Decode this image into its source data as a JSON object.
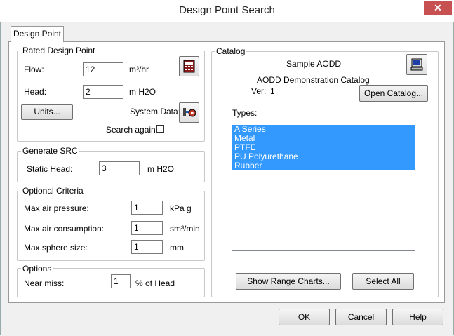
{
  "window": {
    "title": "Design Point Search",
    "close_glyph": "✕"
  },
  "tab": {
    "label": "Design Point"
  },
  "rated": {
    "legend": "Rated Design Point",
    "flow_label": "Flow:",
    "flow_value": "12",
    "flow_unit": "m³/hr",
    "head_label": "Head:",
    "head_value": "2",
    "head_unit": "m H2O",
    "units_button": "Units...",
    "system_data_label": "System Data:",
    "search_again_label": "Search again:",
    "search_again_checked": false
  },
  "generate": {
    "legend": "Generate SRC",
    "static_head_label": "Static Head:",
    "static_head_value": "3",
    "static_head_unit": "m H2O"
  },
  "optional": {
    "legend": "Optional Criteria",
    "rows": [
      {
        "label": "Max air pressure:",
        "value": "1",
        "unit": "kPa g"
      },
      {
        "label": "Max air consumption:",
        "value": "1",
        "unit": "sm³/min"
      },
      {
        "label": "Max sphere size:",
        "value": "1",
        "unit": "mm"
      }
    ]
  },
  "options": {
    "legend": "Options",
    "near_miss_label": "Near miss:",
    "near_miss_value": "1",
    "near_miss_unit": "% of Head"
  },
  "catalog": {
    "legend": "Catalog",
    "name": "Sample AODD",
    "description": "AODD Demonstration Catalog",
    "version_label": "Ver:",
    "version_value": "1",
    "open_button": "Open Catalog...",
    "types_label": "Types:",
    "types": [
      "A Series",
      "Metal",
      "PTFE",
      "PU Polyurethane",
      "Rubber"
    ],
    "show_range_button": "Show Range Charts...",
    "select_all_button": "Select All"
  },
  "footer": {
    "ok": "OK",
    "cancel": "Cancel",
    "help": "Help"
  },
  "colors": {
    "selection": "#3399ff",
    "close": "#c75050"
  }
}
